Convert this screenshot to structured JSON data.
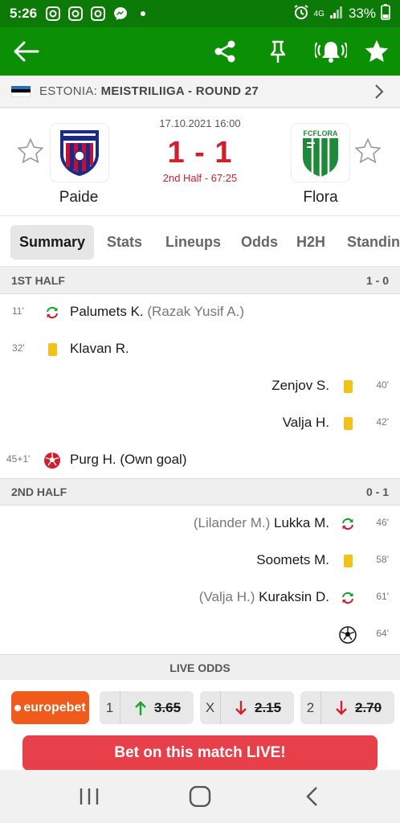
{
  "status_bar": {
    "time": "5:26",
    "network": "4G",
    "battery": "33%"
  },
  "app_bar": {
    "icons": [
      "back-arrow-icon",
      "share-icon",
      "pin-icon",
      "bell-ringing-icon",
      "star-icon"
    ]
  },
  "league": {
    "country": "ESTONIA:",
    "name": "MEISTRILIIGA - ROUND 27",
    "flag_colors": [
      "#1f6fc9",
      "#000000",
      "#ffffff"
    ]
  },
  "match": {
    "datetime": "17.10.2021 16:00",
    "score": "1 - 1",
    "status": "2nd Half - 67:25",
    "home": {
      "name": "Paide"
    },
    "away": {
      "name": "Flora",
      "logo_text": "FCFLORA"
    }
  },
  "tabs": [
    "Summary",
    "Stats",
    "Lineups",
    "Odds",
    "H2H",
    "Standings"
  ],
  "halves": [
    {
      "label": "1ST HALF",
      "score": "1 - 0",
      "events": [
        {
          "minute": "11'",
          "side": "home",
          "type": "substitution",
          "player": "Palumets K.",
          "sub": "(Razak Yusif A.)"
        },
        {
          "minute": "32'",
          "side": "home",
          "type": "yellow-card",
          "player": "Klavan R.",
          "sub": ""
        },
        {
          "minute": "40'",
          "side": "away",
          "type": "yellow-card",
          "player": "Zenjov S.",
          "sub": ""
        },
        {
          "minute": "42'",
          "side": "away",
          "type": "yellow-card",
          "player": "Valja H.",
          "sub": ""
        },
        {
          "minute": "45+1'",
          "side": "home",
          "type": "own-goal",
          "player": "Purg H. (Own goal)",
          "sub": ""
        }
      ]
    },
    {
      "label": "2ND HALF",
      "score": "0 - 1",
      "events": [
        {
          "minute": "46'",
          "side": "away",
          "type": "substitution",
          "player": "Lukka M.",
          "sub": "(Lilander M.)"
        },
        {
          "minute": "58'",
          "side": "away",
          "type": "yellow-card",
          "player": "Soomets M.",
          "sub": ""
        },
        {
          "minute": "61'",
          "side": "away",
          "type": "substitution",
          "player": "Kuraksin D.",
          "sub": "(Valja H.)"
        },
        {
          "minute": "64'",
          "side": "away",
          "type": "goal",
          "player": "",
          "sub": ""
        }
      ]
    }
  ],
  "live_odds": {
    "header": "LIVE ODDS",
    "bookmaker": "europebet",
    "odds": [
      {
        "label": "1",
        "value": "3.65",
        "direction": "up"
      },
      {
        "label": "X",
        "value": "2.15",
        "direction": "down"
      },
      {
        "label": "2",
        "value": "2.70",
        "direction": "down"
      }
    ],
    "bet_button": "Bet on this match LIVE!"
  },
  "colors": {
    "brand_green": "#0b8f05",
    "status_green": "#0b7a06",
    "score_red": "#d0202f",
    "bet_red": "#e8404a",
    "bookie_orange": "#f05a1a",
    "yellow_card": "#f2c21a",
    "odds_up": "#1aa52a",
    "odds_down": "#d0202f"
  }
}
